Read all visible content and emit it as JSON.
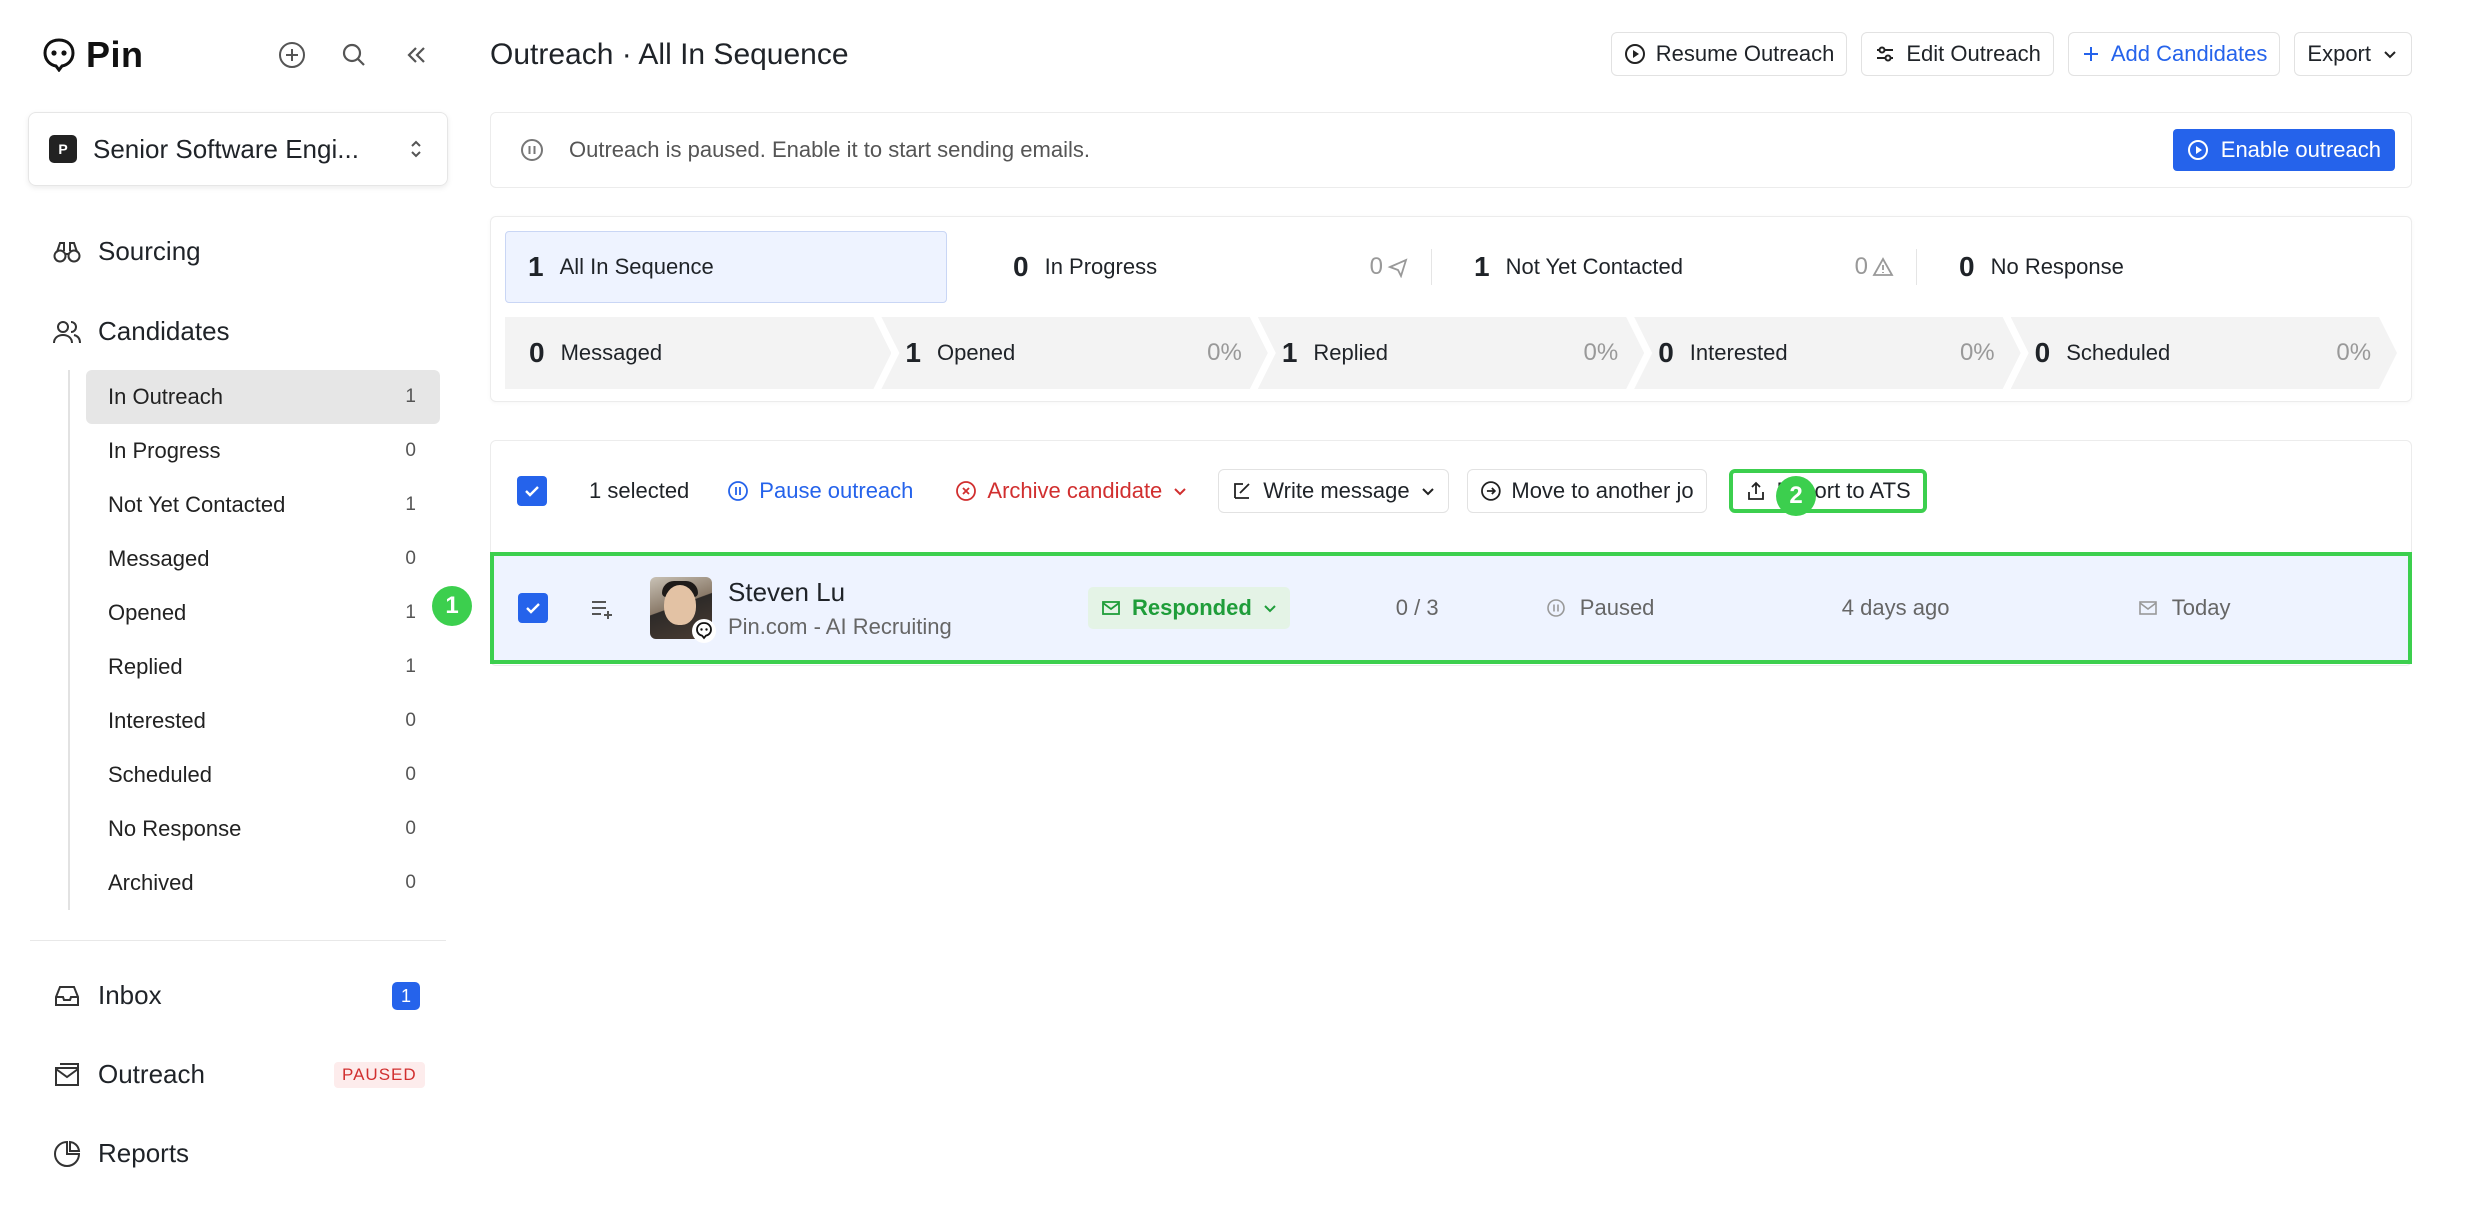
{
  "app": {
    "name": "Pin"
  },
  "sidebar": {
    "job_select": {
      "badge": "P",
      "label": "Senior Software Engi..."
    },
    "sourcing": "Sourcing",
    "candidates": "Candidates",
    "sub_items": [
      {
        "label": "In Outreach",
        "count": "1"
      },
      {
        "label": "In Progress",
        "count": "0"
      },
      {
        "label": "Not Yet Contacted",
        "count": "1"
      },
      {
        "label": "Messaged",
        "count": "0"
      },
      {
        "label": "Opened",
        "count": "1"
      },
      {
        "label": "Replied",
        "count": "1"
      },
      {
        "label": "Interested",
        "count": "0"
      },
      {
        "label": "Scheduled",
        "count": "0"
      },
      {
        "label": "No Response",
        "count": "0"
      },
      {
        "label": "Archived",
        "count": "0"
      }
    ],
    "inbox": {
      "label": "Inbox",
      "badge": "1"
    },
    "outreach": {
      "label": "Outreach",
      "badge": "PAUSED"
    },
    "reports": "Reports"
  },
  "header": {
    "title": "Outreach · All In Sequence",
    "actions": {
      "resume": "Resume Outreach",
      "edit": "Edit Outreach",
      "add": "Add Candidates",
      "export": "Export"
    }
  },
  "banner": {
    "message": "Outreach is paused. Enable it to start sending emails.",
    "button": "Enable outreach"
  },
  "stats": {
    "tabs": [
      {
        "count": "1",
        "label": "All In Sequence",
        "trail": ""
      },
      {
        "count": "0",
        "label": "In Progress",
        "trail": "0"
      },
      {
        "count": "1",
        "label": "Not Yet Contacted",
        "trail": "0"
      },
      {
        "count": "0",
        "label": "No Response",
        "trail": ""
      }
    ],
    "funnel": [
      {
        "count": "0",
        "label": "Messaged",
        "pct": ""
      },
      {
        "count": "1",
        "label": "Opened",
        "pct": "0%"
      },
      {
        "count": "1",
        "label": "Replied",
        "pct": "0%"
      },
      {
        "count": "0",
        "label": "Interested",
        "pct": "0%"
      },
      {
        "count": "0",
        "label": "Scheduled",
        "pct": "0%"
      }
    ]
  },
  "toolbar": {
    "selected": "1 selected",
    "pause": "Pause outreach",
    "archive": "Archive candidate",
    "write": "Write message",
    "move": "Move to another jo",
    "export_ats": "Export to ATS"
  },
  "markers": {
    "one": "1",
    "two": "2"
  },
  "row": {
    "name": "Steven Lu",
    "company": "Pin.com - AI Recruiting",
    "status": "Responded",
    "steps": "0 / 3",
    "state": "Paused",
    "added": "4 days ago",
    "last": "Today"
  },
  "colors": {
    "accent": "#2563eb",
    "success": "#3ccf4e",
    "danger": "#d12f2f"
  }
}
